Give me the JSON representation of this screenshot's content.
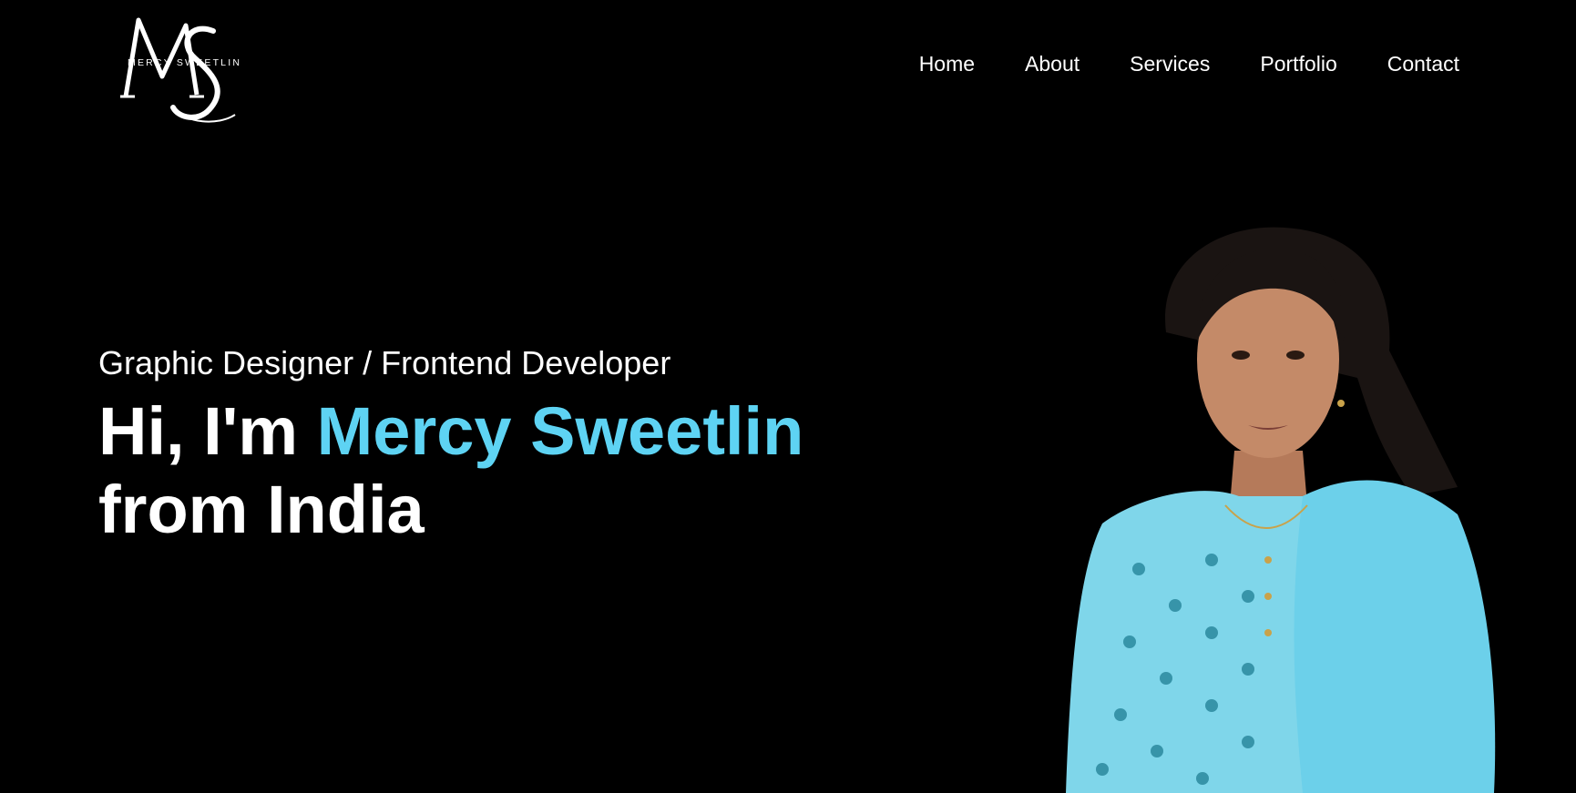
{
  "brand": {
    "logo_monogram": "MS",
    "logo_text": "MERCY SWEETLIN"
  },
  "nav": {
    "items": [
      {
        "label": "Home"
      },
      {
        "label": "About"
      },
      {
        "label": "Services"
      },
      {
        "label": "Portfolio"
      },
      {
        "label": "Contact"
      }
    ]
  },
  "hero": {
    "subtitle": "Graphic Designer / Frontend Developer",
    "greeting": "Hi, I'm",
    "name": "Mercy Sweetlin",
    "line2": "from India"
  },
  "colors": {
    "background": "#000000",
    "text": "#ffffff",
    "accent": "#5ed3f3",
    "dress": "#7fd6ea"
  },
  "portrait": {
    "icon": "person-photo"
  }
}
